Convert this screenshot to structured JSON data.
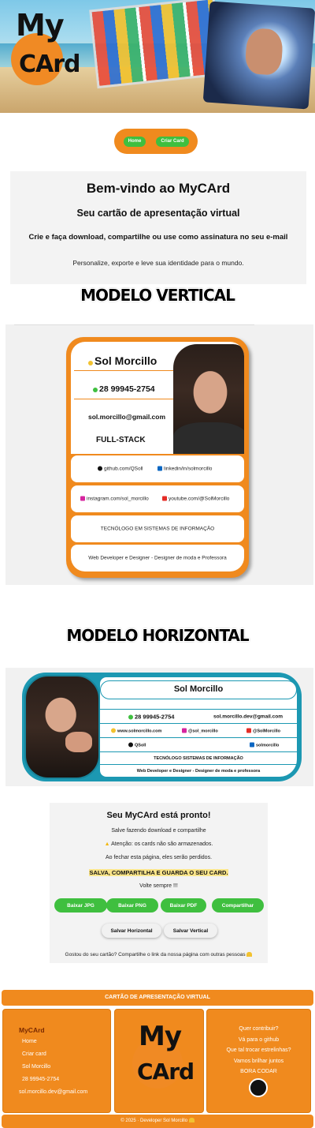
{
  "brand": {
    "logo_text_top": "My",
    "logo_text_bottom": "CArd",
    "accent": "#f08a1e",
    "teal": "#1c98b2",
    "green": "#3fbf3f"
  },
  "nav": {
    "home": "Home",
    "create": "Criar Card"
  },
  "welcome": {
    "title": "Bem-vindo ao MyCArd",
    "subtitle": "Seu cartão de apresentação virtual",
    "tagline": "Crie e faça download, compartilhe ou use como assinatura no seu e-mail",
    "note": "Personalize, exporte e leve sua identidade para o mundo."
  },
  "vertical": {
    "section_title": "MODELO VERTICAL",
    "name": "Sol Morcillo",
    "phone": "28 99945-2754",
    "email": "sol.morcillo@gmail.com",
    "role": "FULL-STACK",
    "github": "github.com/QSoll",
    "linkedin": "linkedin/in/solmorcillo",
    "instagram": "instagram.com/sol_morcillo",
    "youtube": "youtube.com/@SolMorcillo",
    "degree": "TECNÓLOGO EM SISTEMAS DE INFORMAÇÃO",
    "bio": "Web Developer e Designer - Designer de moda e Professora"
  },
  "horizontal": {
    "section_title": "MODELO HORIZONTAL",
    "name": "Sol Morcillo",
    "phone": "28 99945-2754",
    "email": "sol.morcillo.dev@gmail.com",
    "site": "www.solmorcillo.com",
    "instagram": "@sol_morcillo",
    "youtube": "@SolMorcillo",
    "github": "QSoll",
    "linkedin": "solmorcillo",
    "degree": "TECNÓLOGO SISTEMAS DE INFORMAÇÃO",
    "bio": "Web Developer e Designer - Designer de moda e professora"
  },
  "ready": {
    "title": "Seu MyCArd está pronto!",
    "line1": "Salve fazendo download e compartilhe",
    "warning": "Atenção: os cards não são armazenados.",
    "line3": "Ao fechar esta página, eles serão perdidos.",
    "emphasis": "SALVA, COMPARTILHA E GUARDA O SEU CARD.",
    "line5": "Volte sempre !!!",
    "buttons": {
      "jpg": "Baixar JPG",
      "png": "Baixar PNG",
      "pdf": "Baixar PDF",
      "share": "Compartilhar",
      "save_h": "Salvar Horizontal",
      "save_v": "Salvar Vertical"
    },
    "footer_note": "Gostou do seu cartão? Compartilhe o link da nossa página com outras pessoas"
  },
  "footer": {
    "header": "CARTÃO DE APRESENTAÇÃO VIRTUAL",
    "left": {
      "title": "MyCArd",
      "home": "Home",
      "create": "Criar card",
      "name": "Sol Morcillo",
      "phone": "28 99945-2754",
      "email": "sol.morcillo.dev@gmail.com"
    },
    "right": {
      "l1": "Quer contribuir?",
      "l2": "Vá para o github",
      "l3": "Que tal trocar estrelinhas?",
      "l4": "Vamos brilhar juntos",
      "l5": "BORA CODAR"
    },
    "copyright": "© 2025 · Developer Sol Morcillo"
  }
}
